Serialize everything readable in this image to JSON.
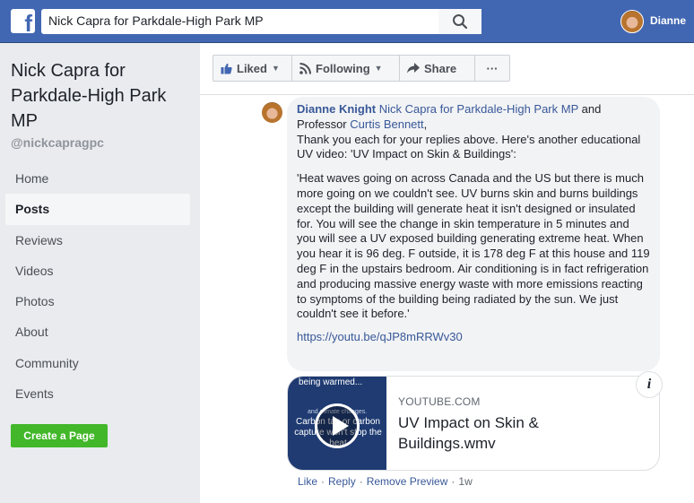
{
  "topbar": {
    "logo_letter": "f",
    "search_value": "Nick Capra for Parkdale-High Park MP",
    "user_name": "Dianne"
  },
  "page": {
    "name": "Nick Capra for Parkdale-High Park MP",
    "handle": "@nickcapragpc"
  },
  "nav": {
    "items": [
      "Home",
      "Posts",
      "Reviews",
      "Videos",
      "Photos",
      "About",
      "Community",
      "Events"
    ],
    "active": "Posts"
  },
  "create_page_label": "Create a Page",
  "actions": {
    "liked": "Liked",
    "following": "Following",
    "share": "Share",
    "more": "···"
  },
  "comment": {
    "author": "Dianne Knight",
    "mention1": "Nick Capra for Parkdale-High Park MP",
    "and_text": "and",
    "prefix2": "Professor",
    "mention2": "Curtis Bennett",
    "comma": ",",
    "intro": "Thank you each for your replies above. Here's another educational UV video: 'UV Impact on Skin & Buildings':",
    "quote": "'Heat waves going on across Canada and the US but there is much more going on we couldn't see. UV burns skin and burns buildings except the building will generate heat it isn't designed or insulated for. You will see the change in skin temperature in 5 minutes and you will see a UV exposed building generating extreme heat. When you hear it is 96 deg. F outside, it is 178 deg F at this house and 119 deg F in the upstairs bedroom. Air conditioning is in fact refrigeration and producing massive energy waste with more emissions reacting to symptoms of the building being radiated by the sun. We just couldn't see it before.'",
    "link": "https://youtu.be/qJP8mRRWv30"
  },
  "preview": {
    "thumb_line1": "being warmed...",
    "thumb_line2": "and climate changes.",
    "thumb_line3": "Carbon tax or carbon capture won't stop the heat",
    "source": "YOUTUBE.COM",
    "title": "UV Impact on Skin & Buildings.wmv",
    "info": "i"
  },
  "comment_actions": {
    "like": "Like",
    "reply": "Reply",
    "remove": "Remove Preview",
    "time": "1w"
  }
}
